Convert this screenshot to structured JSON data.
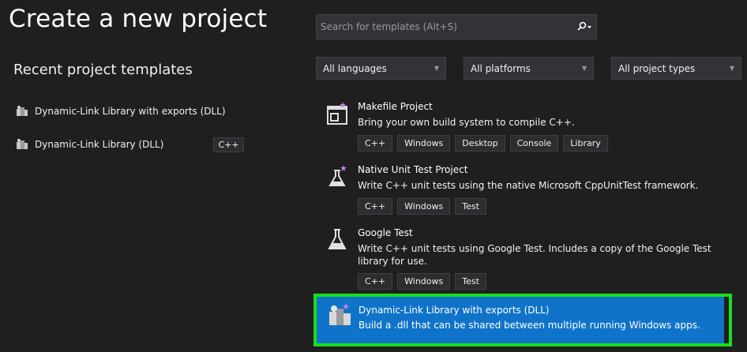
{
  "title": "Create a new project",
  "recent": {
    "heading": "Recent project templates",
    "items": [
      {
        "label": "Dynamic-Link Library with exports (DLL)",
        "icon": "dll-project-icon"
      },
      {
        "label": "Dynamic-Link Library (DLL)",
        "icon": "dll-project-icon",
        "tag": "C++"
      }
    ]
  },
  "search": {
    "placeholder": "Search for templates (Alt+S)",
    "icon": "search-icon"
  },
  "filters": {
    "language": "All languages",
    "platform": "All platforms",
    "project_type": "All project types"
  },
  "templates": [
    {
      "name": "Makefile Project",
      "description": "Bring your own build system to compile C++.",
      "tags": [
        "C++",
        "Windows",
        "Desktop",
        "Console",
        "Library"
      ],
      "icon": "makefile-project-icon"
    },
    {
      "name": "Native Unit Test Project",
      "description": "Write C++ unit tests using the native Microsoft CppUnitTest framework.",
      "tags": [
        "C++",
        "Windows",
        "Test"
      ],
      "icon": "flask-icon"
    },
    {
      "name": "Google Test",
      "description": "Write C++ unit tests using Google Test. Includes a copy of the Google Test library for use.",
      "tags": [
        "C++",
        "Windows",
        "Test"
      ],
      "icon": "flask-icon"
    },
    {
      "name": "Dynamic-Link Library with exports (DLL)",
      "description": "Build a .dll that can be shared between multiple running Windows apps.",
      "selected": true,
      "icon": "dll-project-icon"
    }
  ],
  "colors": {
    "selection": "#0f74c9",
    "highlight_border": "#18e018",
    "background": "#1f1f1f"
  }
}
